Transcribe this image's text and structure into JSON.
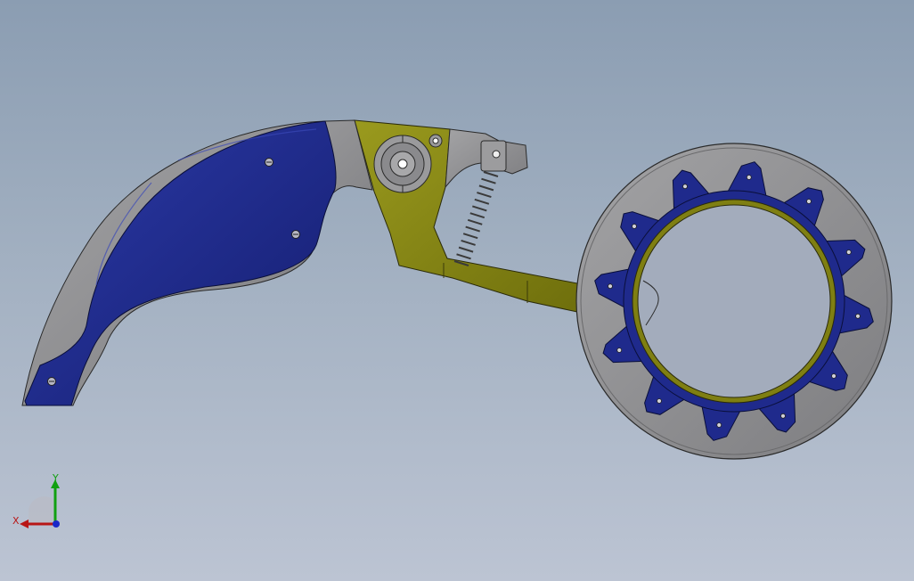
{
  "viewport": {
    "background_top": "#8b9db2",
    "background_bottom": "#bcc4d3"
  },
  "model": {
    "colors": {
      "handle_blue": "#1f2a8c",
      "metal_gray": "#8f8f91",
      "lever_olive": "#7f7f12",
      "edge": "#2a2a2a"
    },
    "ring_tooth_count": 12
  },
  "triad": {
    "x_label": "X",
    "y_label": "Y",
    "x_color": "#b81616",
    "y_color": "#11a011",
    "z_color": "#1a28c8"
  }
}
